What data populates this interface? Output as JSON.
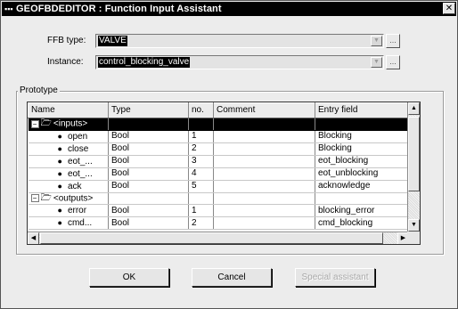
{
  "window": {
    "title": "GEOFBDEDITOR : Function Input Assistant",
    "close_glyph": "✕"
  },
  "form": {
    "ffb_type_label": "FFB type:",
    "ffb_type_value": "VALVE",
    "instance_label": "Instance:",
    "instance_value": "control_blocking_valve",
    "ellipsis_label": "..."
  },
  "prototype": {
    "group_label": "Prototype",
    "columns": [
      "Name",
      "Type",
      "no.",
      "Comment",
      "Entry field"
    ],
    "inputs_label": "<inputs>",
    "outputs_label": "<outputs>",
    "input_rows": [
      {
        "name": "open",
        "type": "Bool",
        "no": "1",
        "comment": "",
        "entry": "Blocking"
      },
      {
        "name": "close",
        "type": "Bool",
        "no": "2",
        "comment": "",
        "entry": "Blocking"
      },
      {
        "name": "eot_...",
        "type": "Bool",
        "no": "3",
        "comment": "",
        "entry": "eot_blocking"
      },
      {
        "name": "eot_...",
        "type": "Bool",
        "no": "4",
        "comment": "",
        "entry": "eot_unblocking"
      },
      {
        "name": "ack",
        "type": "Bool",
        "no": "5",
        "comment": "",
        "entry": "acknowledge"
      }
    ],
    "output_rows": [
      {
        "name": "error",
        "type": "Bool",
        "no": "1",
        "comment": "",
        "entry": "blocking_error"
      },
      {
        "name": "cmd...",
        "type": "Bool",
        "no": "2",
        "comment": "",
        "entry": "cmd_blocking"
      }
    ]
  },
  "buttons": {
    "ok": "OK",
    "cancel": "Cancel",
    "special": "Special assistant"
  }
}
